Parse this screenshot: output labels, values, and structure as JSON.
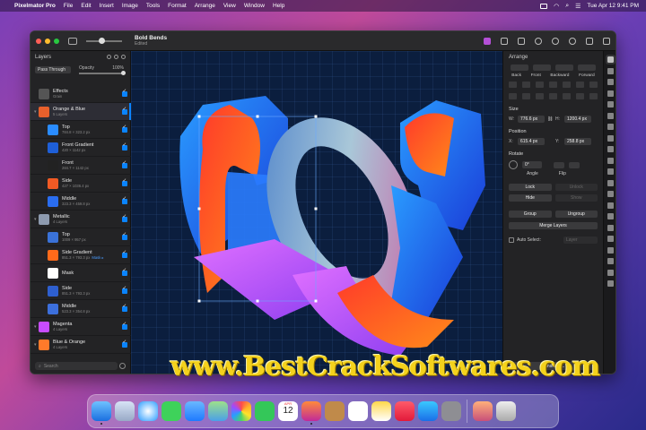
{
  "menubar": {
    "app_name": "Pixelmator Pro",
    "menus": [
      "File",
      "Edit",
      "Insert",
      "Image",
      "Tools",
      "Format",
      "Arrange",
      "View",
      "Window",
      "Help"
    ],
    "datetime": "Tue Apr 12  9:41 PM"
  },
  "document": {
    "title": "Bold Bends",
    "status": "Edited"
  },
  "layers_panel": {
    "title": "Layers",
    "blend_mode": "Pass Through",
    "opacity_label": "Opacity",
    "opacity_value": "100%",
    "search_placeholder": "Search",
    "items": [
      {
        "name": "Effects",
        "detail": "Grain",
        "level": 0,
        "thumb": "#555"
      },
      {
        "name": "Orange & Blue",
        "detail": "5 Layers",
        "level": 0,
        "thumb": "#e8602c",
        "selected": true
      },
      {
        "name": "Top",
        "detail": "784.8 × 323.2 px",
        "level": 1,
        "thumb": "#2a8cff"
      },
      {
        "name": "Front Gradient",
        "detail": "420 × 1142 px",
        "level": 1,
        "thumb": "#1e5fd8"
      },
      {
        "name": "Front",
        "detail": "284.7 × 1142 px",
        "level": 1,
        "thumb": "#222"
      },
      {
        "name": "Side",
        "detail": "427 × 1036.4 px",
        "level": 1,
        "thumb": "#f15a24"
      },
      {
        "name": "Middle",
        "detail": "323.3 × 459.8 px",
        "level": 1,
        "thumb": "#2a6df0"
      },
      {
        "name": "Metallic",
        "detail": "4 Layers",
        "level": 0,
        "thumb": "#8d9aaf"
      },
      {
        "name": "Top",
        "detail": "1009 × 957 px",
        "level": 1,
        "thumb": "#3a72d8"
      },
      {
        "name": "Side Gradient",
        "detail": "851.3 × 793.3 px",
        "link": "Mask ▸",
        "level": 1,
        "thumb": "#ff6a1a"
      },
      {
        "name": "Mask",
        "detail": "",
        "level": 1,
        "thumb": "#fff"
      },
      {
        "name": "Side",
        "detail": "851.3 × 793.3 px",
        "level": 1,
        "thumb": "#2e5fcf"
      },
      {
        "name": "Middle",
        "detail": "523.3 × 354.8 px",
        "level": 1,
        "thumb": "#3c6fdc"
      },
      {
        "name": "Magenta",
        "detail": "4 Layers",
        "level": 0,
        "thumb": "#c84cff"
      },
      {
        "name": "Blue & Orange",
        "detail": "4 Layers",
        "level": 0,
        "thumb": "#ff7a2a"
      }
    ]
  },
  "arrange_panel": {
    "title": "Arrange",
    "order_buttons": [
      "Back",
      "Front",
      "Backward",
      "Forward"
    ],
    "size_label": "Size",
    "width_label": "W:",
    "width_value": "776.6 px",
    "height_label": "H:",
    "height_value": "1200.4 px",
    "position_label": "Position",
    "x_label": "X:",
    "x_value": "615.4 px",
    "y_label": "Y:",
    "y_value": "258.8 px",
    "rotate_label": "Rotate",
    "angle_value": "0°",
    "angle_label": "Angle",
    "flip_label": "Flip",
    "lock": "Lock",
    "unlock": "Unlock",
    "hide": "Hide",
    "show": "Show",
    "group": "Group",
    "ungroup": "Ungroup",
    "merge": "Merge Layers",
    "auto_select": "Auto Select:",
    "auto_select_value": "Layer",
    "transform": "Transform..."
  },
  "watermark": "www.BestCrackSoftwares.com",
  "calendar": {
    "month": "APR",
    "day": "12"
  },
  "colors": {
    "accent": "#0a84ff",
    "orange": "#ff5a1f",
    "blue": "#1f6fff",
    "magenta": "#c944ff"
  }
}
